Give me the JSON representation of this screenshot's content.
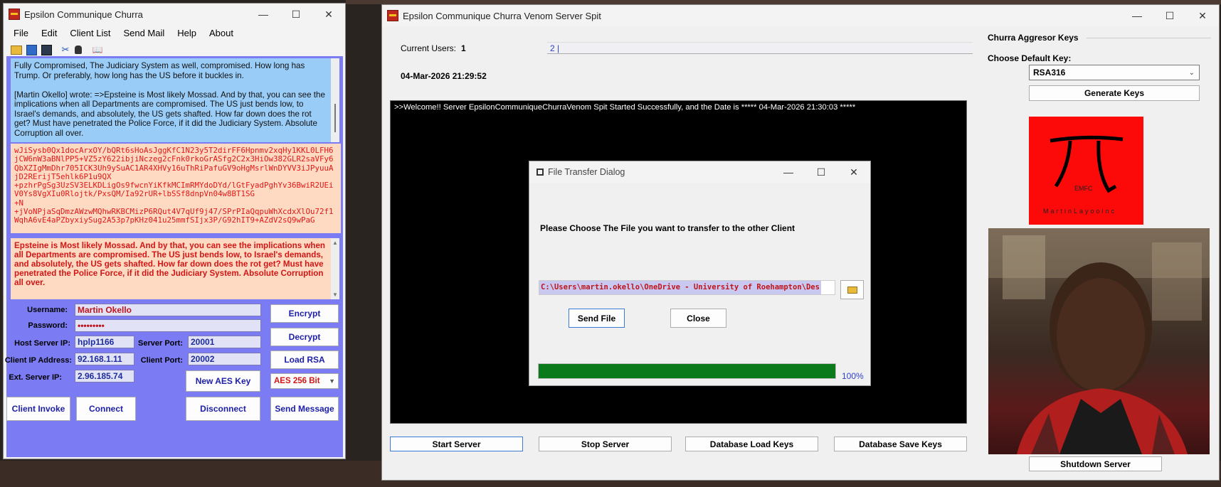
{
  "client": {
    "title": "Epsilon Communique Churra",
    "menu": [
      "File",
      "Edit",
      "Client List",
      "Send Mail",
      "Help",
      "About"
    ],
    "chat_text": "Fully Compromised, The Judiciary System as well, compromised. How long has Trump. Or preferably, how long has the US before it buckles in.\n\n[Martin Okello] wrote: =>Epsteine is Most likely Mossad. And by that, you can see the implications when all Departments are compromised. The US just bends low, to Israel's demands, and absolutely, the US gets shafted. How far down does the rot get? Must have penetrated the Police Force, if it did the Judiciary System. Absolute Corruption all over.",
    "cipher_text": "wJiSysb0Qx1docArxOY/bQRt6sHoAsJggKfC1N23y5T2dirFF6Hpnmv2xqHy1KKL0LFH6jCW6nW3aBNlPP5+VZ5zY622ibjiNczeg2cFnk0rkoGrASfg2C2x3HiOw382GLR2saVFy6QbXZIgMmDhr705ICK3Uh9ySuAC1AR4XHVy16uThRiPafuGV9oHgMsrlWnDYVV3iJPyuuAjD2RErijT5ehlk6P1u9QX\n+pzhrPgSg3UzSV3ELKDLigOs9fwcnYiKfkMCImRMYdoDYd/lGtFyadPghYv36BwiR2UEiV0Ys8VgXIu0Rlojtk/PxsQM/Ia92rUR+lbSSf8dnpVn04w8BT1SG\n+N\n+jVoNPjaSqDmzAWzwMQhwRKBCMizP6RQut4V7qUf9j47/SPrPIaQqpuWhXcdxXlOu72f1WqhA6vE4aPZbyxiySug2A53p7pKHz041u25mmfSIjx3P/G92hIT9+AZdV2sQ9wPaG",
    "plain_text": "Epsteine is Most likely Mossad. And by that, you can see the implications when all Departments are compromised. The US just bends low, to Israel's demands, and absolutely, the US gets shafted. How far down does the rot get? Must have penetrated the Police Force, if it did the Judiciary System. Absolute Corruption all over.",
    "form": {
      "username_label": "Username:",
      "username": "Martin Okello",
      "password_label": "Password:",
      "password": "•••••••••",
      "host_ip_label": "Host Server IP:",
      "host_ip": "hplp1166",
      "server_port_label": "Server Port:",
      "server_port": "20001",
      "client_ip_label": "Client IP Address:",
      "client_ip": "92.168.1.11",
      "client_port_label": "Client Port:",
      "client_port": "20002",
      "ext_ip_label": "Ext. Server IP:",
      "ext_ip": "2.96.185.74"
    },
    "buttons": {
      "encrypt": "Encrypt",
      "decrypt": "Decrypt",
      "load_rsa": "Load RSA",
      "new_aes": "New AES Key",
      "aes_select": "AES 256 Bit",
      "client_invoke": "Client Invoke",
      "connect": "Connect",
      "disconnect": "Disconnect",
      "send_message": "Send Message"
    },
    "colors": {
      "panel": "#7b7bf4",
      "chat_bg": "#99ccf7",
      "cipher_bg": "#ffdac2",
      "cipher_text": "#e21818"
    }
  },
  "server": {
    "title": "Epsilon Communique Churra Venom Server Spit",
    "current_users_label": "Current Users:",
    "current_users": "1",
    "users_box": "2 |",
    "datetime": "04-Mar-2026 21:29:52",
    "console_line": ">>Welcome!! Server EpsilonCommuniqueChurraVenom Spit Started Successfully, and the Date is ***** 04-Mar-2026 21:30:03 *****",
    "keys_heading": "Churra Aggresor Keys",
    "default_key_label": "Choose Default Key:",
    "default_key": "RSA316",
    "generate_keys": "Generate Keys",
    "logo_text_emfc": "EMFC",
    "logo_text_name": "MartinLayooinc",
    "buttons": {
      "start": "Start Server",
      "stop": "Stop Server",
      "db_load": "Database Load Keys",
      "db_save": "Database Save Keys",
      "shutdown": "Shutdown Server"
    }
  },
  "dialog": {
    "title": "File Transfer Dialog",
    "prompt": "Please Choose The File you want to transfer to the other Client",
    "path": "C:\\Users\\martin.okello\\OneDrive - University of Roehampton\\Des",
    "send_file": "Send File",
    "close": "Close",
    "progress": 1.0,
    "progress_label": "100%"
  }
}
